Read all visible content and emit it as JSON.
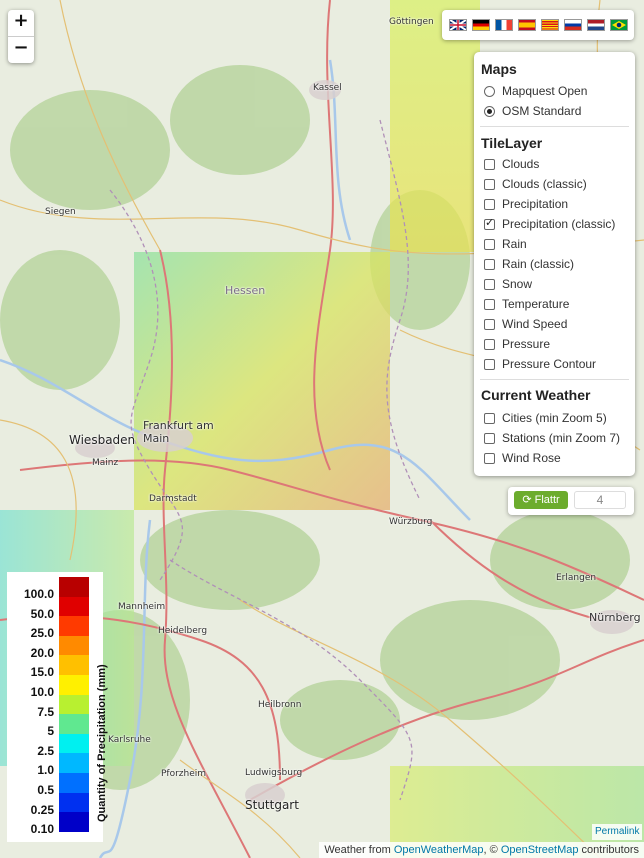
{
  "zoom": {
    "in": "+",
    "out": "−"
  },
  "languages": [
    "en-icon",
    "de-icon",
    "fr-icon",
    "es-icon",
    "ca-icon",
    "ru-icon",
    "nl-icon",
    "br-icon"
  ],
  "layers_panel": {
    "maps_title": "Maps",
    "base_layers": [
      {
        "label": "Mapquest Open",
        "checked": false
      },
      {
        "label": "OSM Standard",
        "checked": true
      }
    ],
    "tile_title": "TileLayer",
    "tile_layers": [
      {
        "label": "Clouds",
        "checked": false
      },
      {
        "label": "Clouds (classic)",
        "checked": false
      },
      {
        "label": "Precipitation",
        "checked": false
      },
      {
        "label": "Precipitation (classic)",
        "checked": true
      },
      {
        "label": "Rain",
        "checked": false
      },
      {
        "label": "Rain (classic)",
        "checked": false
      },
      {
        "label": "Snow",
        "checked": false
      },
      {
        "label": "Temperature",
        "checked": false
      },
      {
        "label": "Wind Speed",
        "checked": false
      },
      {
        "label": "Pressure",
        "checked": false
      },
      {
        "label": "Pressure Contour",
        "checked": false
      }
    ],
    "weather_title": "Current Weather",
    "weather_layers": [
      {
        "label": "Cities (min Zoom 5)",
        "checked": false
      },
      {
        "label": "Stations (min Zoom 7)",
        "checked": false
      },
      {
        "label": "Wind Rose",
        "checked": false
      }
    ]
  },
  "flattr": {
    "label": "Flattr",
    "count": "4"
  },
  "legend": {
    "title": "Quantity of Precipitation (mm)",
    "values": [
      "100.0",
      "50.0",
      "25.0",
      "20.0",
      "15.0",
      "10.0",
      "7.5",
      "5",
      "2.5",
      "1.0",
      "0.5",
      "0.25",
      "0.10"
    ],
    "colors": [
      "#b80000",
      "#e00000",
      "#ff3a00",
      "#ff8a00",
      "#ffc000",
      "#fff000",
      "#b8f030",
      "#60e890",
      "#00f0f0",
      "#00b8ff",
      "#0070ff",
      "#0030f0",
      "#0000c8"
    ]
  },
  "cities": [
    "Göttingen",
    "Kassel",
    "Siegen",
    "Hessen",
    "Wiesbaden",
    "Frankfurt am Main",
    "Mainz",
    "Darmstadt",
    "Würzburg",
    "Erlangen",
    "Nürnberg",
    "Mannheim",
    "Heidelberg",
    "Heilbronn",
    "Karlsruhe",
    "Pforzheim",
    "Ludwigsburg",
    "Stuttgart"
  ],
  "attribution": {
    "prefix": "Weather from ",
    "owm": "OpenWeatherMap",
    "sep": ", © ",
    "osm": "OpenStreetMap",
    "suffix": " contributors"
  },
  "permalink": "Permalink"
}
